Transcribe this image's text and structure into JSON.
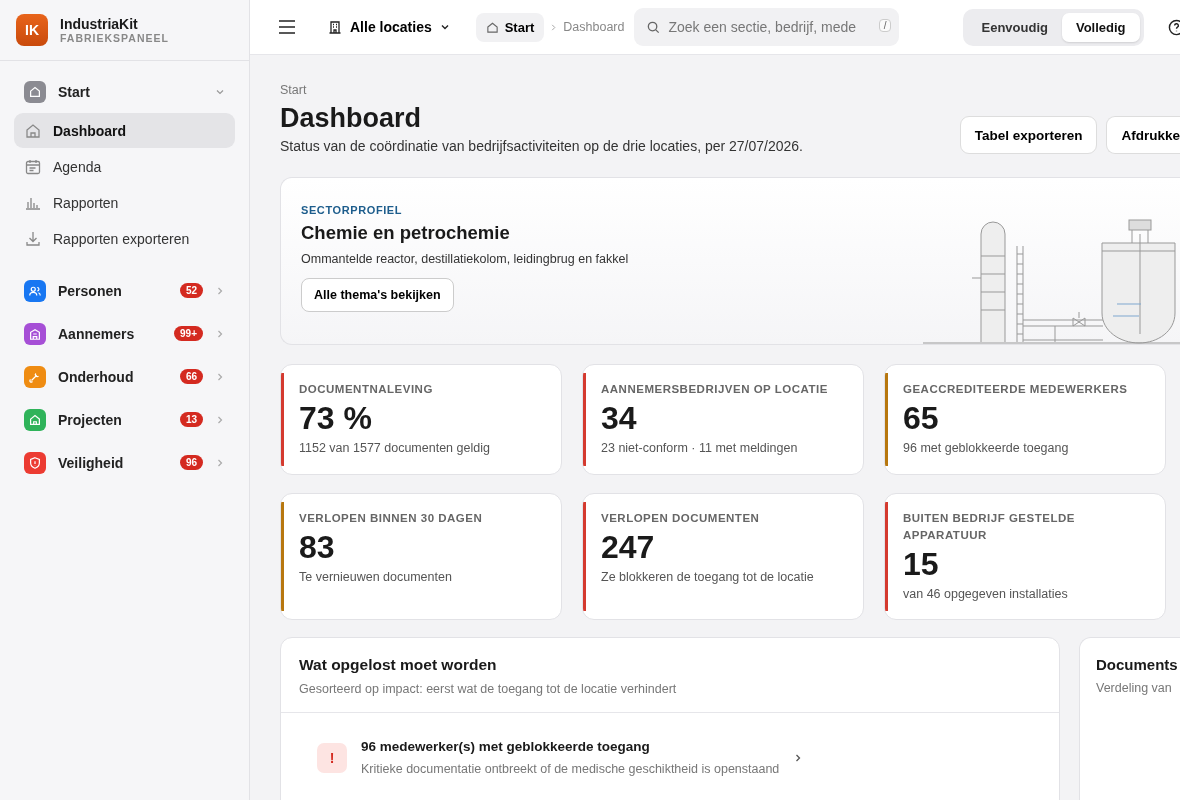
{
  "brand": {
    "logo": "IK",
    "name": "IndustriaKit",
    "subtitle": "FABRIEKSPANEEL"
  },
  "sidebar": {
    "group": {
      "label": "Start",
      "expanded": true,
      "items": [
        {
          "label": "Dashboard",
          "selected": true
        },
        {
          "label": "Agenda",
          "selected": false
        },
        {
          "label": "Rapporten",
          "selected": false
        },
        {
          "label": "Rapporten exporteren",
          "selected": false
        }
      ]
    },
    "sections": [
      {
        "label": "Personen",
        "badge": "52",
        "color": "#1877f2"
      },
      {
        "label": "Aannemers",
        "badge": "99+",
        "color": "#a64fd6"
      },
      {
        "label": "Onderhoud",
        "badge": "66",
        "color": "#ef8c12"
      },
      {
        "label": "Projecten",
        "badge": "13",
        "color": "#2fb35a"
      },
      {
        "label": "Veiligheid",
        "badge": "96",
        "color": "#ec3b32"
      }
    ]
  },
  "topbar": {
    "location": "Alle locaties",
    "breadcrumb": [
      "Start",
      "Dashboard"
    ],
    "search": {
      "placeholder": "Zoek een sectie, bedrijf, mede",
      "shortcut": "/"
    },
    "modes": [
      {
        "label": "Eenvoudig",
        "selected": false
      },
      {
        "label": "Volledig",
        "selected": true
      }
    ]
  },
  "page": {
    "eyebrow": "Start",
    "title": "Dashboard",
    "subtitle": "Status van de coördinatie van bedrijfsactiviteiten op de drie locaties, per 27/07/2026.",
    "actions": [
      "Tabel exporteren",
      "Afdrukke"
    ]
  },
  "hero": {
    "eyebrow": "SECTORPROFIEL",
    "title": "Chemie en petrochemie",
    "description": "Ommantelde reactor, destillatiekolom, leidingbrug en fakkel",
    "button": "Alle thema's bekijken"
  },
  "stats": [
    {
      "label": "DOCUMENTNALEVING",
      "value": "73 %",
      "detail": "1152 van 1577 documenten geldig",
      "color": "#d43a2f"
    },
    {
      "label": "AANNEMERSBEDRIJVEN OP LOCATIE",
      "value": "34",
      "detail": "23 niet-conform · 11 met meldingen",
      "color": "#d43a2f"
    },
    {
      "label": "GEACCREDITEERDE MEDEWERKERS",
      "value": "65",
      "detail": "96 met geblokkeerde toegang",
      "color": "#b7770f"
    },
    {
      "label": "VERLOPEN BINNEN 30 DAGEN",
      "value": "83",
      "detail": "Te vernieuwen documenten",
      "color": "#b7770f"
    },
    {
      "label": "VERLOPEN DOCUMENTEN",
      "value": "247",
      "detail": "Ze blokkeren de toegang tot de locatie",
      "color": "#d43a2f"
    },
    {
      "label": "BUITEN BEDRIJF GESTELDE APPARATUUR",
      "value": "15",
      "detail": "van 46 opgegeven installaties",
      "color": "#d43a2f"
    }
  ],
  "todo": {
    "title": "Wat opgelost moet worden",
    "subtitle": "Gesorteerd op impact: eerst wat de toegang tot de locatie verhindert",
    "items": [
      {
        "icon": "!",
        "title": "96 medewerker(s) met geblokkeerde toegang",
        "description": "Kritieke documentatie ontbreekt of de medische geschiktheid is openstaand"
      }
    ]
  },
  "side_panel": {
    "title": "Documents",
    "subtitle": "Verdeling van"
  }
}
